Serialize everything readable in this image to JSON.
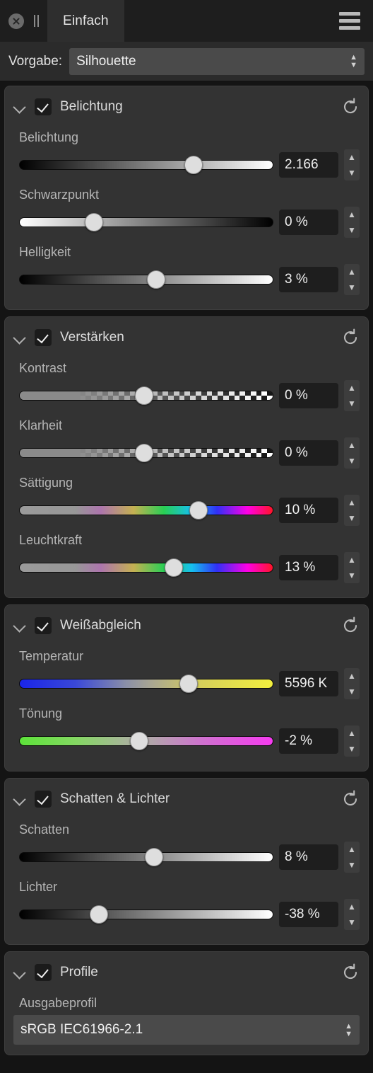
{
  "titlebar": {
    "close_icon": "close-circle-icon",
    "grip_icon": "drag-handle-icon",
    "tab_label": "Einfach",
    "menu_icon": "hamburger-menu-icon"
  },
  "preset": {
    "label": "Vorgabe:",
    "value": "Silhouette"
  },
  "colors": {
    "panel_bg": "#333333",
    "window_bg": "#141414",
    "titlebar_bg": "#1e1e1e",
    "tab_active_bg": "#2e2e2e",
    "combo_bg": "#4a4a4a",
    "value_bg": "#1e1e1e",
    "text": "#dcdcdc"
  },
  "sections": [
    {
      "title": "Belichtung",
      "checked": true,
      "reset_icon": "reset-icon",
      "chevron_icon": "chevron-down-icon",
      "sliders": [
        {
          "label": "Belichtung",
          "value": "2.166",
          "pos": 70,
          "gradient": "black-to-white"
        },
        {
          "label": "Schwarzpunkt",
          "value": "0 %",
          "pos": 30,
          "gradient": "white-to-black"
        },
        {
          "label": "Helligkeit",
          "value": "3 %",
          "pos": 55,
          "gradient": "black-to-white"
        }
      ]
    },
    {
      "title": "Verstärken",
      "checked": true,
      "reset_icon": "reset-icon",
      "chevron_icon": "chevron-down-icon",
      "sliders": [
        {
          "label": "Kontrast",
          "value": "0 %",
          "pos": 50,
          "gradient": "checker-contrast"
        },
        {
          "label": "Klarheit",
          "value": "0 %",
          "pos": 50,
          "gradient": "checker-contrast"
        },
        {
          "label": "Sättigung",
          "value": "10 %",
          "pos": 72,
          "gradient": "gray-to-rainbow"
        },
        {
          "label": "Leuchtkraft",
          "value": "13 %",
          "pos": 62,
          "gradient": "gray-to-rainbow"
        }
      ]
    },
    {
      "title": "Weißabgleich",
      "checked": true,
      "reset_icon": "reset-icon",
      "chevron_icon": "chevron-down-icon",
      "sliders": [
        {
          "label": "Temperatur",
          "value": "5596 K",
          "pos": 68,
          "gradient": "blue-gray-yellow"
        },
        {
          "label": "Tönung",
          "value": "-2 %",
          "pos": 48,
          "gradient": "green-gray-magenta"
        }
      ]
    },
    {
      "title": "Schatten & Lichter",
      "checked": true,
      "reset_icon": "reset-icon",
      "chevron_icon": "chevron-down-icon",
      "sliders": [
        {
          "label": "Schatten",
          "value": "8 %",
          "pos": 54,
          "gradient": "black-to-white"
        },
        {
          "label": "Lichter",
          "value": "-38 %",
          "pos": 32,
          "gradient": "black-to-white"
        }
      ]
    },
    {
      "title": "Profile",
      "checked": true,
      "reset_icon": "reset-icon",
      "chevron_icon": "chevron-down-icon",
      "sliders": [],
      "profile": {
        "label": "Ausgabeprofil",
        "value": "sRGB IEC61966-2.1"
      }
    }
  ]
}
